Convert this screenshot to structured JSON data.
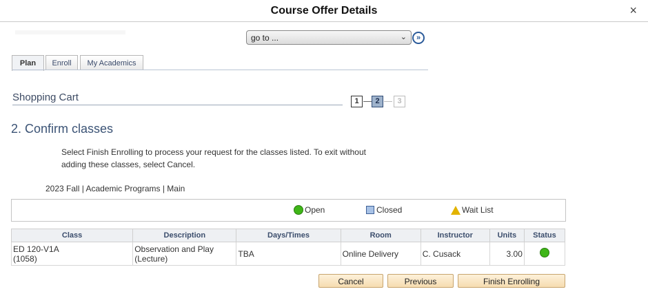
{
  "dialog": {
    "title": "Course Offer Details",
    "close_glyph": "×"
  },
  "nav": {
    "goto_value": "go to ...",
    "go_icon": "double-chevron-right-icon"
  },
  "tabs": [
    {
      "label": "Plan",
      "active": true
    },
    {
      "label": "Enroll",
      "active": false
    },
    {
      "label": "My Academics",
      "active": false
    }
  ],
  "cart": {
    "title": "Shopping Cart",
    "steps": [
      "1",
      "2",
      "3"
    ],
    "current_step": 2
  },
  "page": {
    "heading": "2.  Confirm classes",
    "instructions": "Select Finish Enrolling to process your request for the classes listed. To exit without adding these classes, select Cancel.",
    "term": "2023 Fall | Academic Programs | Main"
  },
  "legend": {
    "open": "Open",
    "closed": "Closed",
    "waitlist": "Wait List",
    "colors": {
      "open": "#3fb618",
      "closed": "#a8c2e6",
      "waitlist": "#e2b300"
    }
  },
  "table": {
    "headers": [
      "Class",
      "Description",
      "Days/Times",
      "Room",
      "Instructor",
      "Units",
      "Status"
    ],
    "rows": [
      {
        "class_code": "ED 120-V1A",
        "class_nbr": "(1058)",
        "description": "Observation and Play (Lecture)",
        "days_times": "TBA",
        "room": "Online Delivery",
        "instructor": "C. Cusack",
        "units": "3.00",
        "status": "Open"
      }
    ]
  },
  "buttons": {
    "cancel": "Cancel",
    "previous": "Previous",
    "finish": "Finish Enrolling"
  }
}
